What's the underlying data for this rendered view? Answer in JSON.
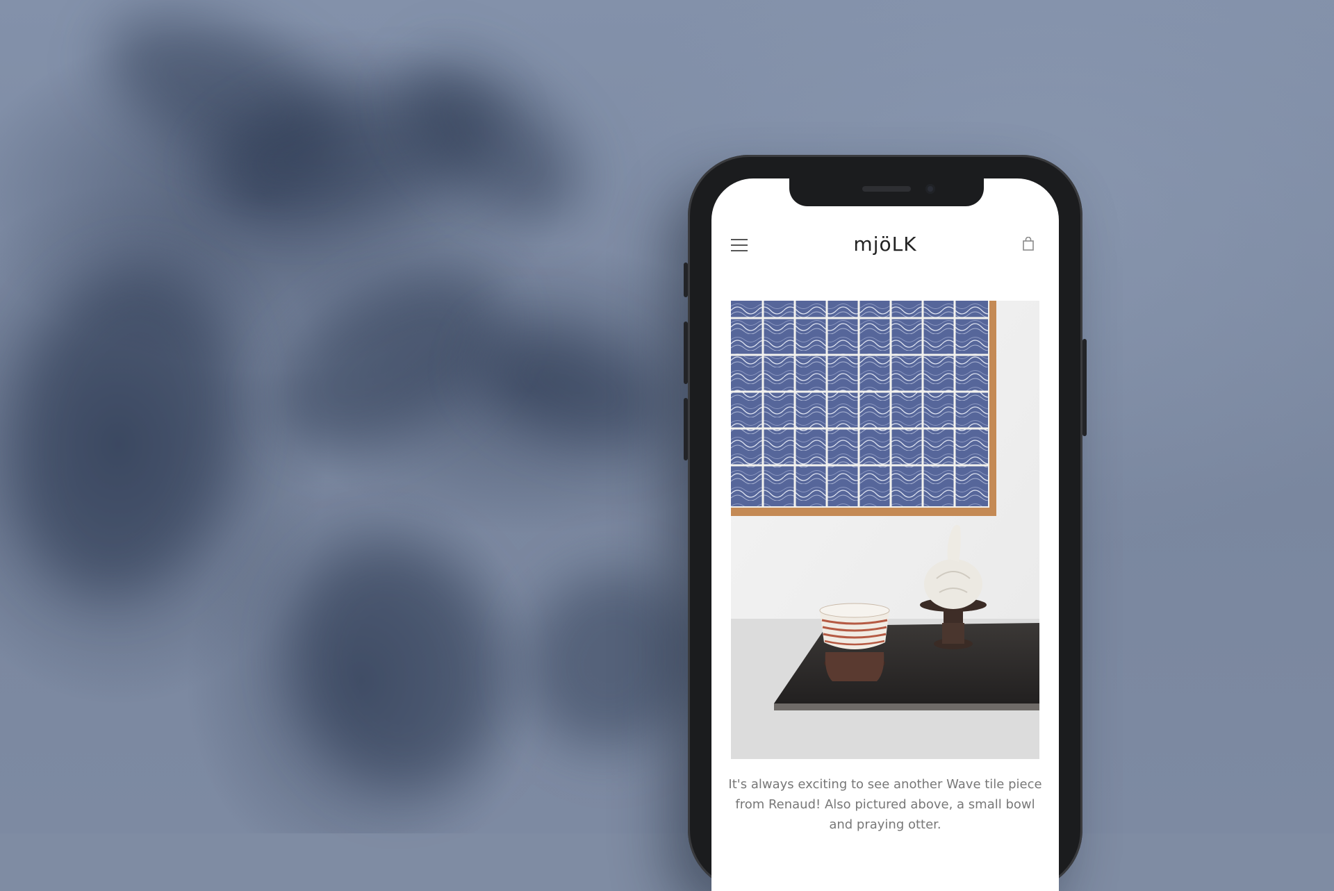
{
  "app": {
    "logo": "mjöLK"
  },
  "post": {
    "caption": "It's always exciting to see another Wave tile piece from Renaud! Also pictured above, a small bowl and praying otter."
  },
  "icons": {
    "menu": "hamburger-menu-icon",
    "cart": "shopping-bag-icon"
  },
  "colors": {
    "backdrop": "#7f8ca3",
    "tile_blue": "#4f5f8c",
    "frame_wood": "#c48a55"
  }
}
